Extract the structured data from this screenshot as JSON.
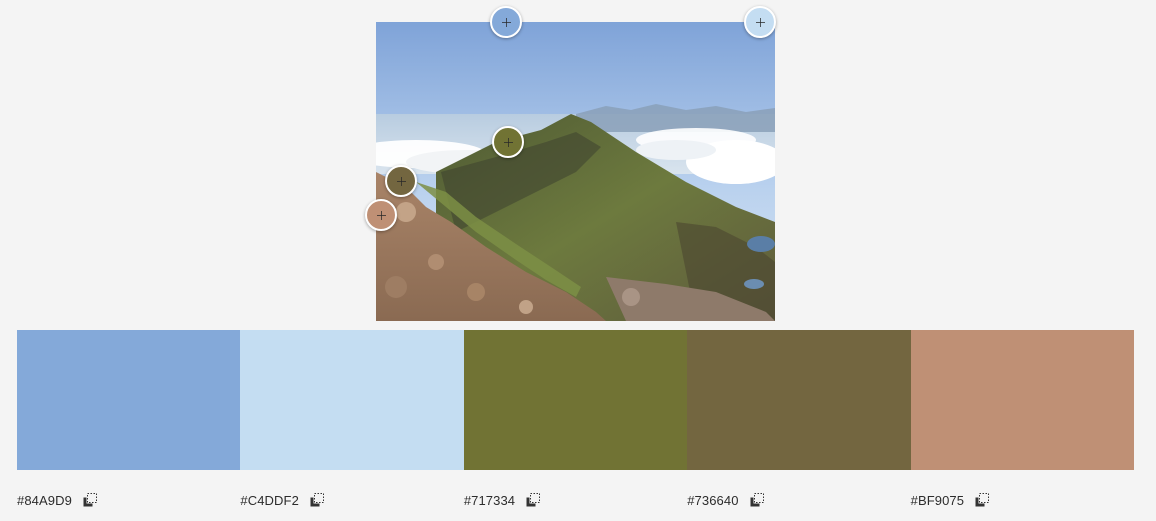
{
  "image": {
    "alt_icon": "mountain-photo"
  },
  "pickers": [
    {
      "icon": "color-picker-handle",
      "color": "#84A9D9"
    },
    {
      "icon": "color-picker-handle",
      "color": "#C4DDF2"
    },
    {
      "icon": "color-picker-handle",
      "color": "#717334"
    },
    {
      "icon": "color-picker-handle",
      "color": "#736640"
    },
    {
      "icon": "color-picker-handle",
      "color": "#BF9075"
    }
  ],
  "swatches": [
    {
      "hex": "#84A9D9",
      "color": "#84A9D9",
      "copy_icon": "copy-icon"
    },
    {
      "hex": "#C4DDF2",
      "color": "#C4DDF2",
      "copy_icon": "copy-icon"
    },
    {
      "hex": "#717334",
      "color": "#717334",
      "copy_icon": "copy-icon"
    },
    {
      "hex": "#736640",
      "color": "#736640",
      "copy_icon": "copy-icon"
    },
    {
      "hex": "#BF9075",
      "color": "#BF9075",
      "copy_icon": "copy-icon"
    }
  ]
}
